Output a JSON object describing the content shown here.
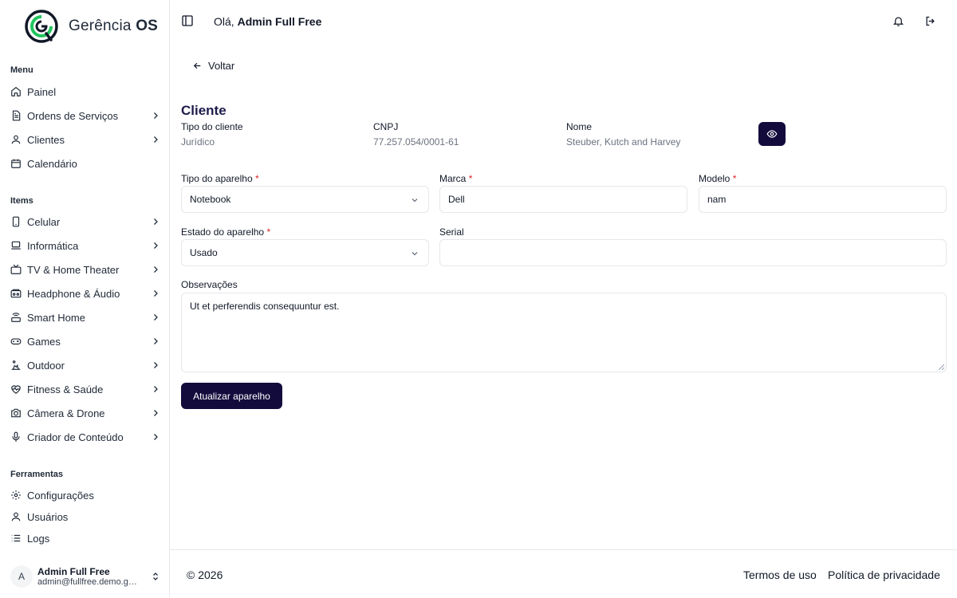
{
  "brand": {
    "name_light": "Gerência ",
    "name_bold": "OS",
    "accent_color": "#22c55e",
    "dark_color": "#111827"
  },
  "sidebar": {
    "sections": {
      "menu": "Menu",
      "items": "Items",
      "tools": "Ferramentas"
    },
    "menu": [
      {
        "label": "Painel",
        "icon": "home-icon",
        "chevron": false
      },
      {
        "label": "Ordens de Serviços",
        "icon": "document-icon",
        "chevron": true
      },
      {
        "label": "Clientes",
        "icon": "user-icon",
        "chevron": true
      },
      {
        "label": "Calendário",
        "icon": "calendar-icon",
        "chevron": false
      }
    ],
    "items": [
      {
        "label": "Celular",
        "icon": "smartphone-icon"
      },
      {
        "label": "Informática",
        "icon": "laptop-icon"
      },
      {
        "label": "TV & Home Theater",
        "icon": "tv-icon"
      },
      {
        "label": "Headphone & Áudio",
        "icon": "speaker-icon"
      },
      {
        "label": "Smart Home",
        "icon": "smart-home-icon"
      },
      {
        "label": "Games",
        "icon": "gamepad-icon"
      },
      {
        "label": "Outdoor",
        "icon": "outdoor-icon"
      },
      {
        "label": "Fitness & Saúde",
        "icon": "heart-pulse-icon"
      },
      {
        "label": "Câmera & Drone",
        "icon": "camera-icon"
      },
      {
        "label": "Criador de Conteúdo",
        "icon": "microphone-icon"
      }
    ],
    "tools": [
      {
        "label": "Configurações",
        "icon": "gear-icon"
      },
      {
        "label": "Usuários",
        "icon": "user-icon"
      },
      {
        "label": "Logs",
        "icon": "list-icon"
      }
    ],
    "user": {
      "initial": "A",
      "name": "Admin Full Free",
      "email": "admin@fullfree.demo.gerenciaos.com"
    }
  },
  "header": {
    "greeting_prefix": "Olá, ",
    "user_name": "Admin Full Free"
  },
  "main": {
    "back_label": "Voltar",
    "client_heading": "Cliente",
    "client": [
      {
        "label": "Tipo do cliente",
        "value": "Jurídico"
      },
      {
        "label": "CNPJ",
        "value": "77.257.054/0001-61"
      },
      {
        "label": "Nome",
        "value": "Steuber, Kutch and Harvey"
      }
    ],
    "form": {
      "device_type": {
        "label": "Tipo do aparelho",
        "value": "Notebook"
      },
      "brand": {
        "label": "Marca",
        "value": "Dell"
      },
      "model": {
        "label": "Modelo",
        "value": "nam"
      },
      "state": {
        "label": "Estado do aparelho",
        "value": "Usado"
      },
      "serial": {
        "label": "Serial",
        "value": ""
      },
      "notes": {
        "label": "Observações",
        "value": "Ut et perferendis consequuntur est."
      },
      "required_mark": "*",
      "submit_label": "Atualizar aparelho"
    }
  },
  "footer": {
    "copyright": "© 2026",
    "terms": "Termos de uso",
    "privacy": "Política de privacidade"
  },
  "colors": {
    "primary": "#140b3d",
    "required": "#dc2626",
    "muted_text": "#6b7280"
  }
}
